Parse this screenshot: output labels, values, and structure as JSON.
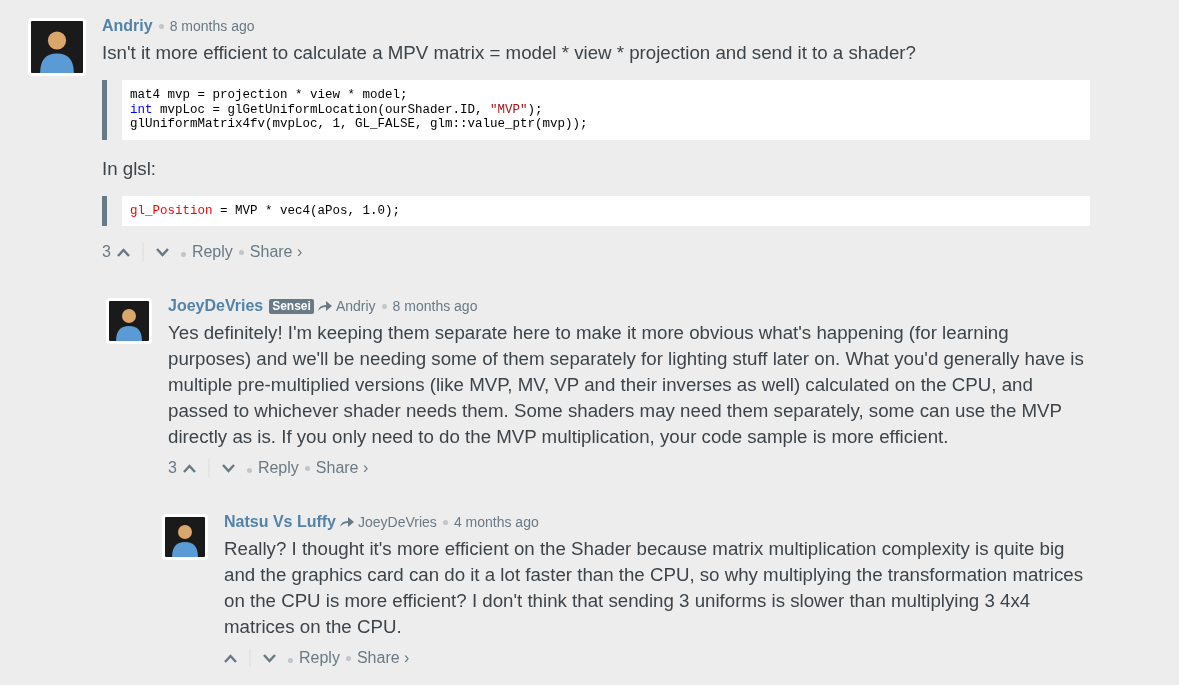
{
  "comments": [
    {
      "author": "Andriy",
      "meta": "8 months ago",
      "body": [
        {
          "kind": "paragraph",
          "text": "Isn't it more efficient to calculate a MPV matrix = model * view * projection and send it to a shader?"
        },
        {
          "kind": "code",
          "lines": [
            [
              {
                "kind": "plain",
                "text": "mat4 mvp = projection * view * model;"
              }
            ],
            [
              {
                "kind": "keyword",
                "text": "int"
              },
              {
                "kind": "plain",
                "text": " mvpLoc = glGetUniformLocation(ourShader.ID, "
              },
              {
                "kind": "string",
                "text": "\"MVP\""
              },
              {
                "kind": "plain",
                "text": ");"
              }
            ],
            [
              {
                "kind": "plain",
                "text": "glUniformMatrix4fv(mvpLoc, 1, GL_FALSE, glm::value_ptr(mvp));"
              }
            ]
          ]
        },
        {
          "kind": "paragraph",
          "text": "In glsl:"
        },
        {
          "kind": "code",
          "lines": [
            [
              {
                "kind": "builtin",
                "text": "gl_Position"
              },
              {
                "kind": "plain",
                "text": " = MVP * vec4(aPos, 1.0);"
              }
            ]
          ]
        }
      ],
      "votes": "3",
      "reply": "Reply",
      "share": "Share ›",
      "children": [
        {
          "author": "JoeyDeVries",
          "badge": "Sensei",
          "reply_to": "Andriy",
          "meta": "8 months ago",
          "body": [
            {
              "kind": "paragraph",
              "text": "Yes definitely! I'm keeping them separate here to make it more obvious what's happening (for learning purposes) and we'll be needing some of them separately for lighting stuff later on. What you'd generally have is multiple pre-multiplied versions (like MVP, MV, VP and their inverses as well) calculated on the CPU, and passed to whichever shader needs them. Some shaders may need them separately, some can use the MVP directly as is. If you only need to do the MVP multiplication, your code sample is more efficient."
            }
          ],
          "votes": "3",
          "reply": "Reply",
          "share": "Share ›",
          "children": [
            {
              "author": "Natsu Vs Luffy",
              "reply_to": "JoeyDeVries",
              "meta": "4 months ago",
              "body": [
                {
                  "kind": "paragraph",
                  "text": "Really? I thought it's more efficient on the Shader because matrix multiplication complexity is quite big and the graphics card can do it a lot faster than the CPU, so why multiplying the transformation matrices on the CPU is more efficient? I don't think that sending 3 uniforms is slower than multiplying 3 4x4 matrices on the CPU."
                }
              ],
              "reply": "Reply",
              "share": "Share ›"
            }
          ]
        }
      ]
    }
  ]
}
